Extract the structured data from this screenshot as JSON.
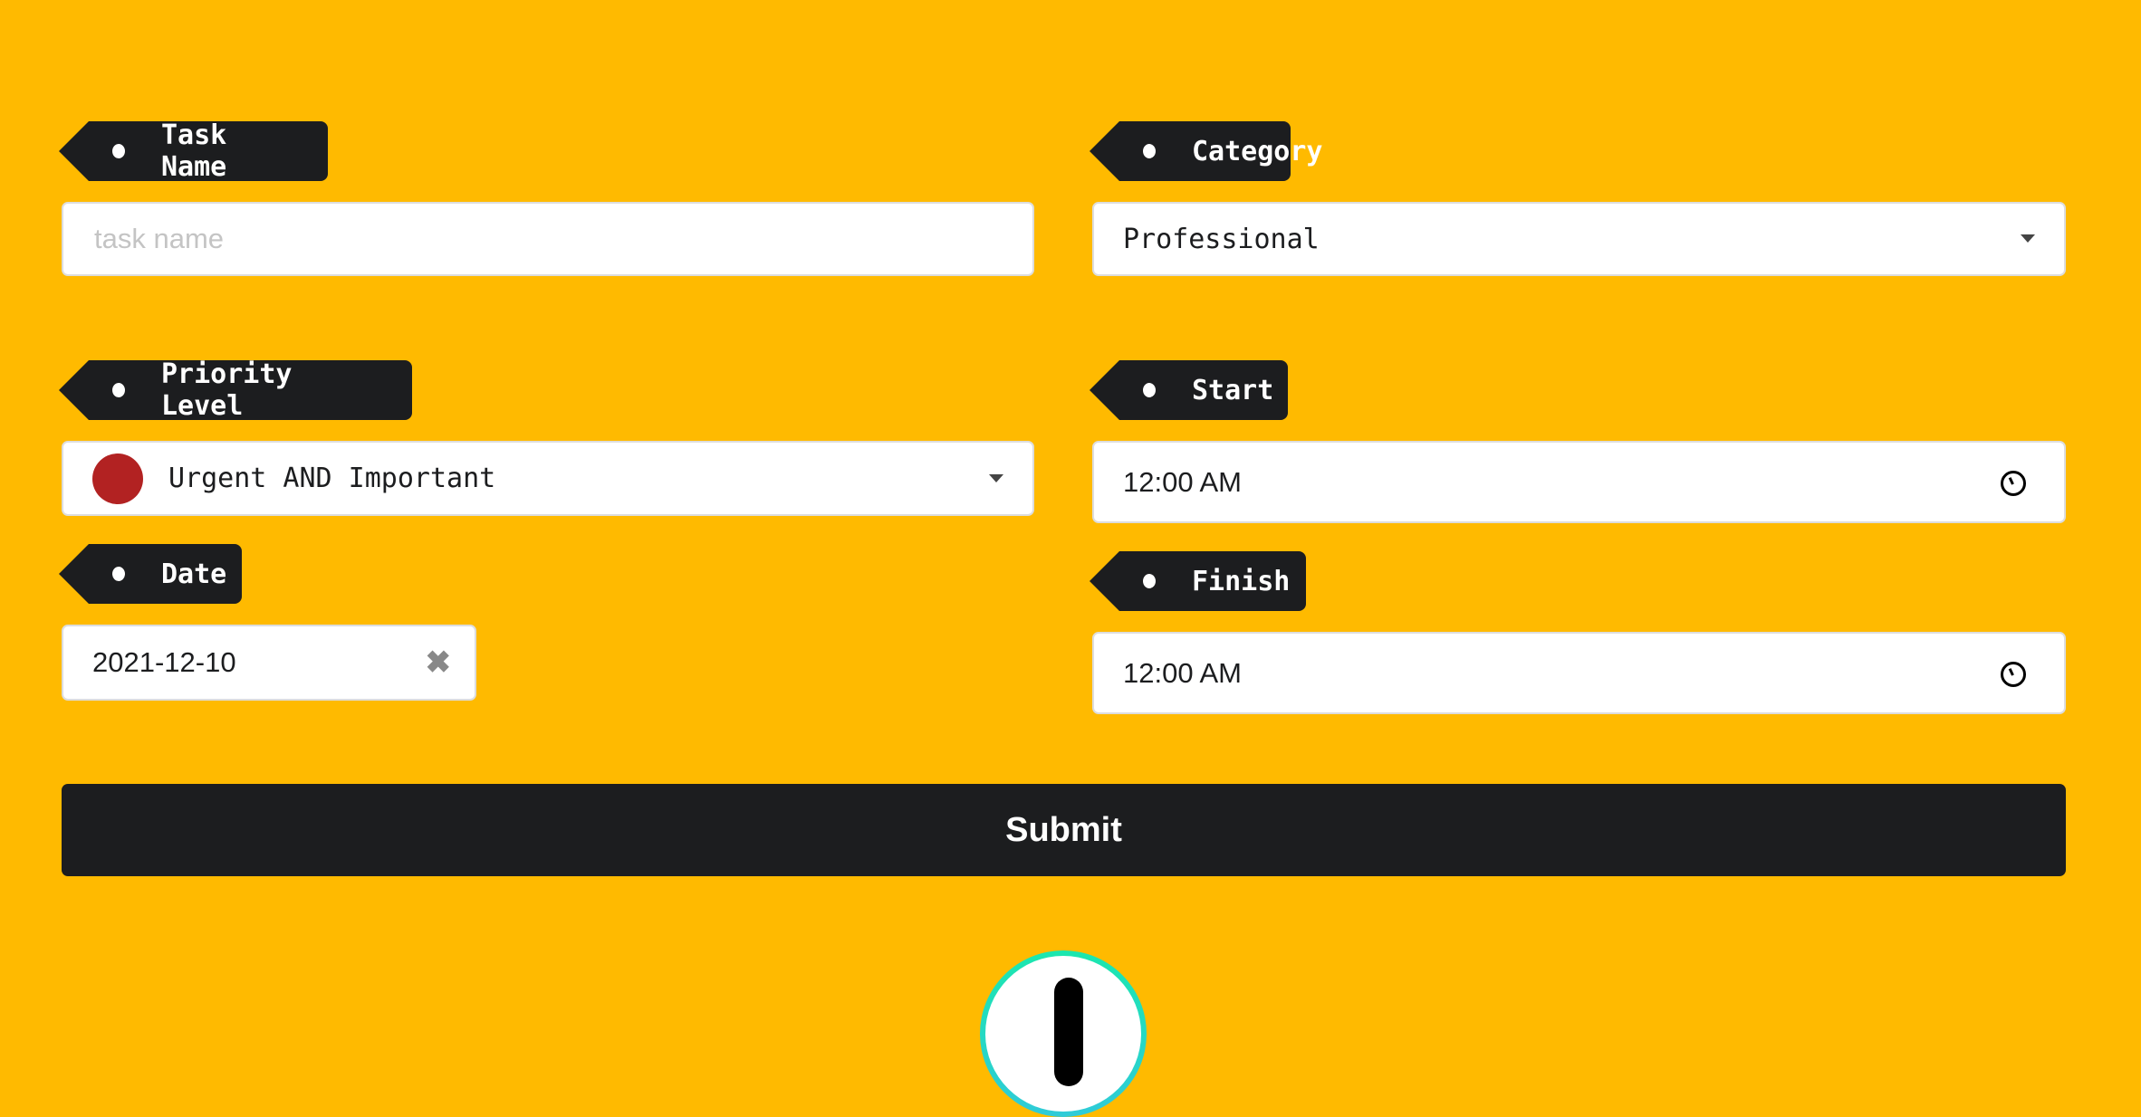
{
  "colors": {
    "background": "#FFBA00",
    "label_bg": "#1C1D1F",
    "priority_urgent": "#B22222",
    "badge_ring": "#1BE7AE"
  },
  "labels": {
    "task_name": "Task Name",
    "category": "Category",
    "priority": "Priority Level",
    "date": "Date",
    "start": "Start",
    "finish": "Finish"
  },
  "task_name": {
    "value": "",
    "placeholder": "task name"
  },
  "category": {
    "selected": "Professional"
  },
  "priority": {
    "selected": "Urgent AND Important",
    "icon": "red-circle"
  },
  "date": {
    "value": "2021-12-10",
    "clear_icon": "x-icon"
  },
  "start": {
    "value": "12:00 AM",
    "icon": "clock-icon"
  },
  "finish": {
    "value": "12:00 AM",
    "icon": "clock-icon"
  },
  "submit": {
    "label": "Submit"
  }
}
